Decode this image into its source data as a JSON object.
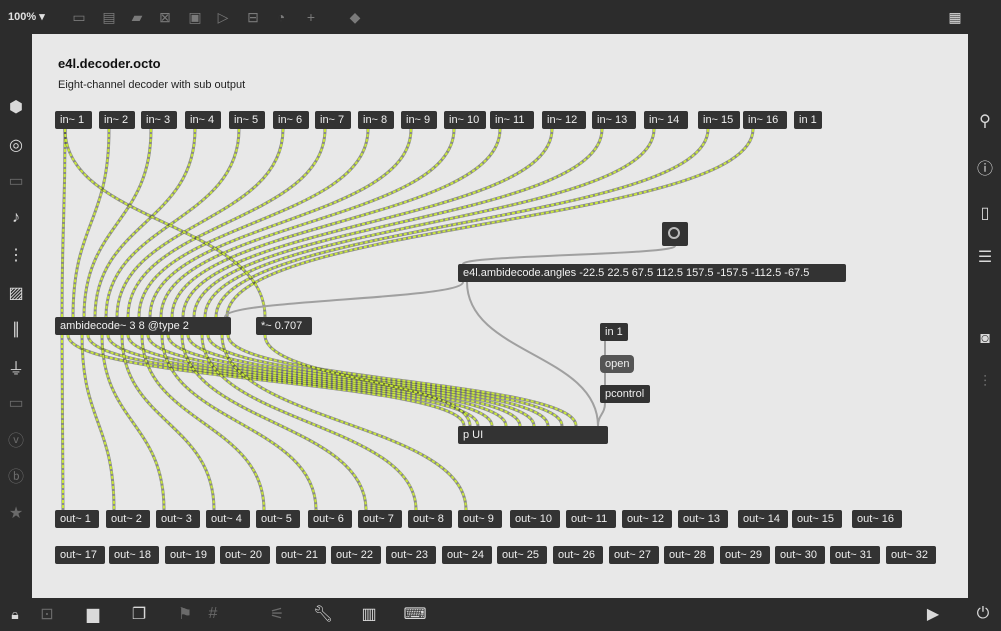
{
  "toolbar": {
    "zoom": "100%",
    "icons": [
      "new-object-icon",
      "message-icon",
      "comment-icon",
      "button-icon",
      "toggle-icon",
      "number-icon",
      "slider-icon",
      "dial-icon",
      "plus-icon",
      "paint-bucket-icon",
      "grid-pattern-icon"
    ]
  },
  "patcher": {
    "title": "e4l.decoder.octo",
    "subtitle": "Eight-channel decoder with sub output",
    "inlets": [
      "in~ 1",
      "in~ 2",
      "in~ 3",
      "in~ 4",
      "in~ 5",
      "in~ 6",
      "in~ 7",
      "in~ 8",
      "in~ 9",
      "in~ 10",
      "in~ 11",
      "in~ 12",
      "in~ 13",
      "in~ 14",
      "in~ 15",
      "in~ 16",
      "in 1"
    ],
    "outlets_row1": [
      "out~ 1",
      "out~ 2",
      "out~ 3",
      "out~ 4",
      "out~ 5",
      "out~ 6",
      "out~ 7",
      "out~ 8",
      "out~ 9",
      "out~ 10",
      "out~ 11",
      "out~ 12",
      "out~ 13",
      "out~ 14",
      "out~ 15",
      "out~ 16"
    ],
    "outlets_row2": [
      "out~ 17",
      "out~ 18",
      "out~ 19",
      "out~ 20",
      "out~ 21",
      "out~ 22",
      "out~ 23",
      "out~ 24",
      "out~ 25",
      "out~ 26",
      "out~ 27",
      "out~ 28",
      "out~ 29",
      "out~ 30",
      "out~ 31",
      "out~ 32"
    ],
    "objects": {
      "angles": "e4l.ambidecode.angles -22.5 22.5 67.5 112.5 157.5 -157.5 -112.5 -67.5",
      "decoder": "ambidecode~ 3 8 @type 2",
      "gain": "*~ 0.707",
      "in1b": "in 1",
      "open": "open",
      "pcontrol": "pcontrol",
      "pui": "p UI"
    }
  },
  "colors": {
    "canvas": "#e8e8e8",
    "chrome": "#2c2c2c",
    "object": "#333333",
    "signal_cord": "#c8e63c",
    "control_cord": "#a0a0a0"
  }
}
